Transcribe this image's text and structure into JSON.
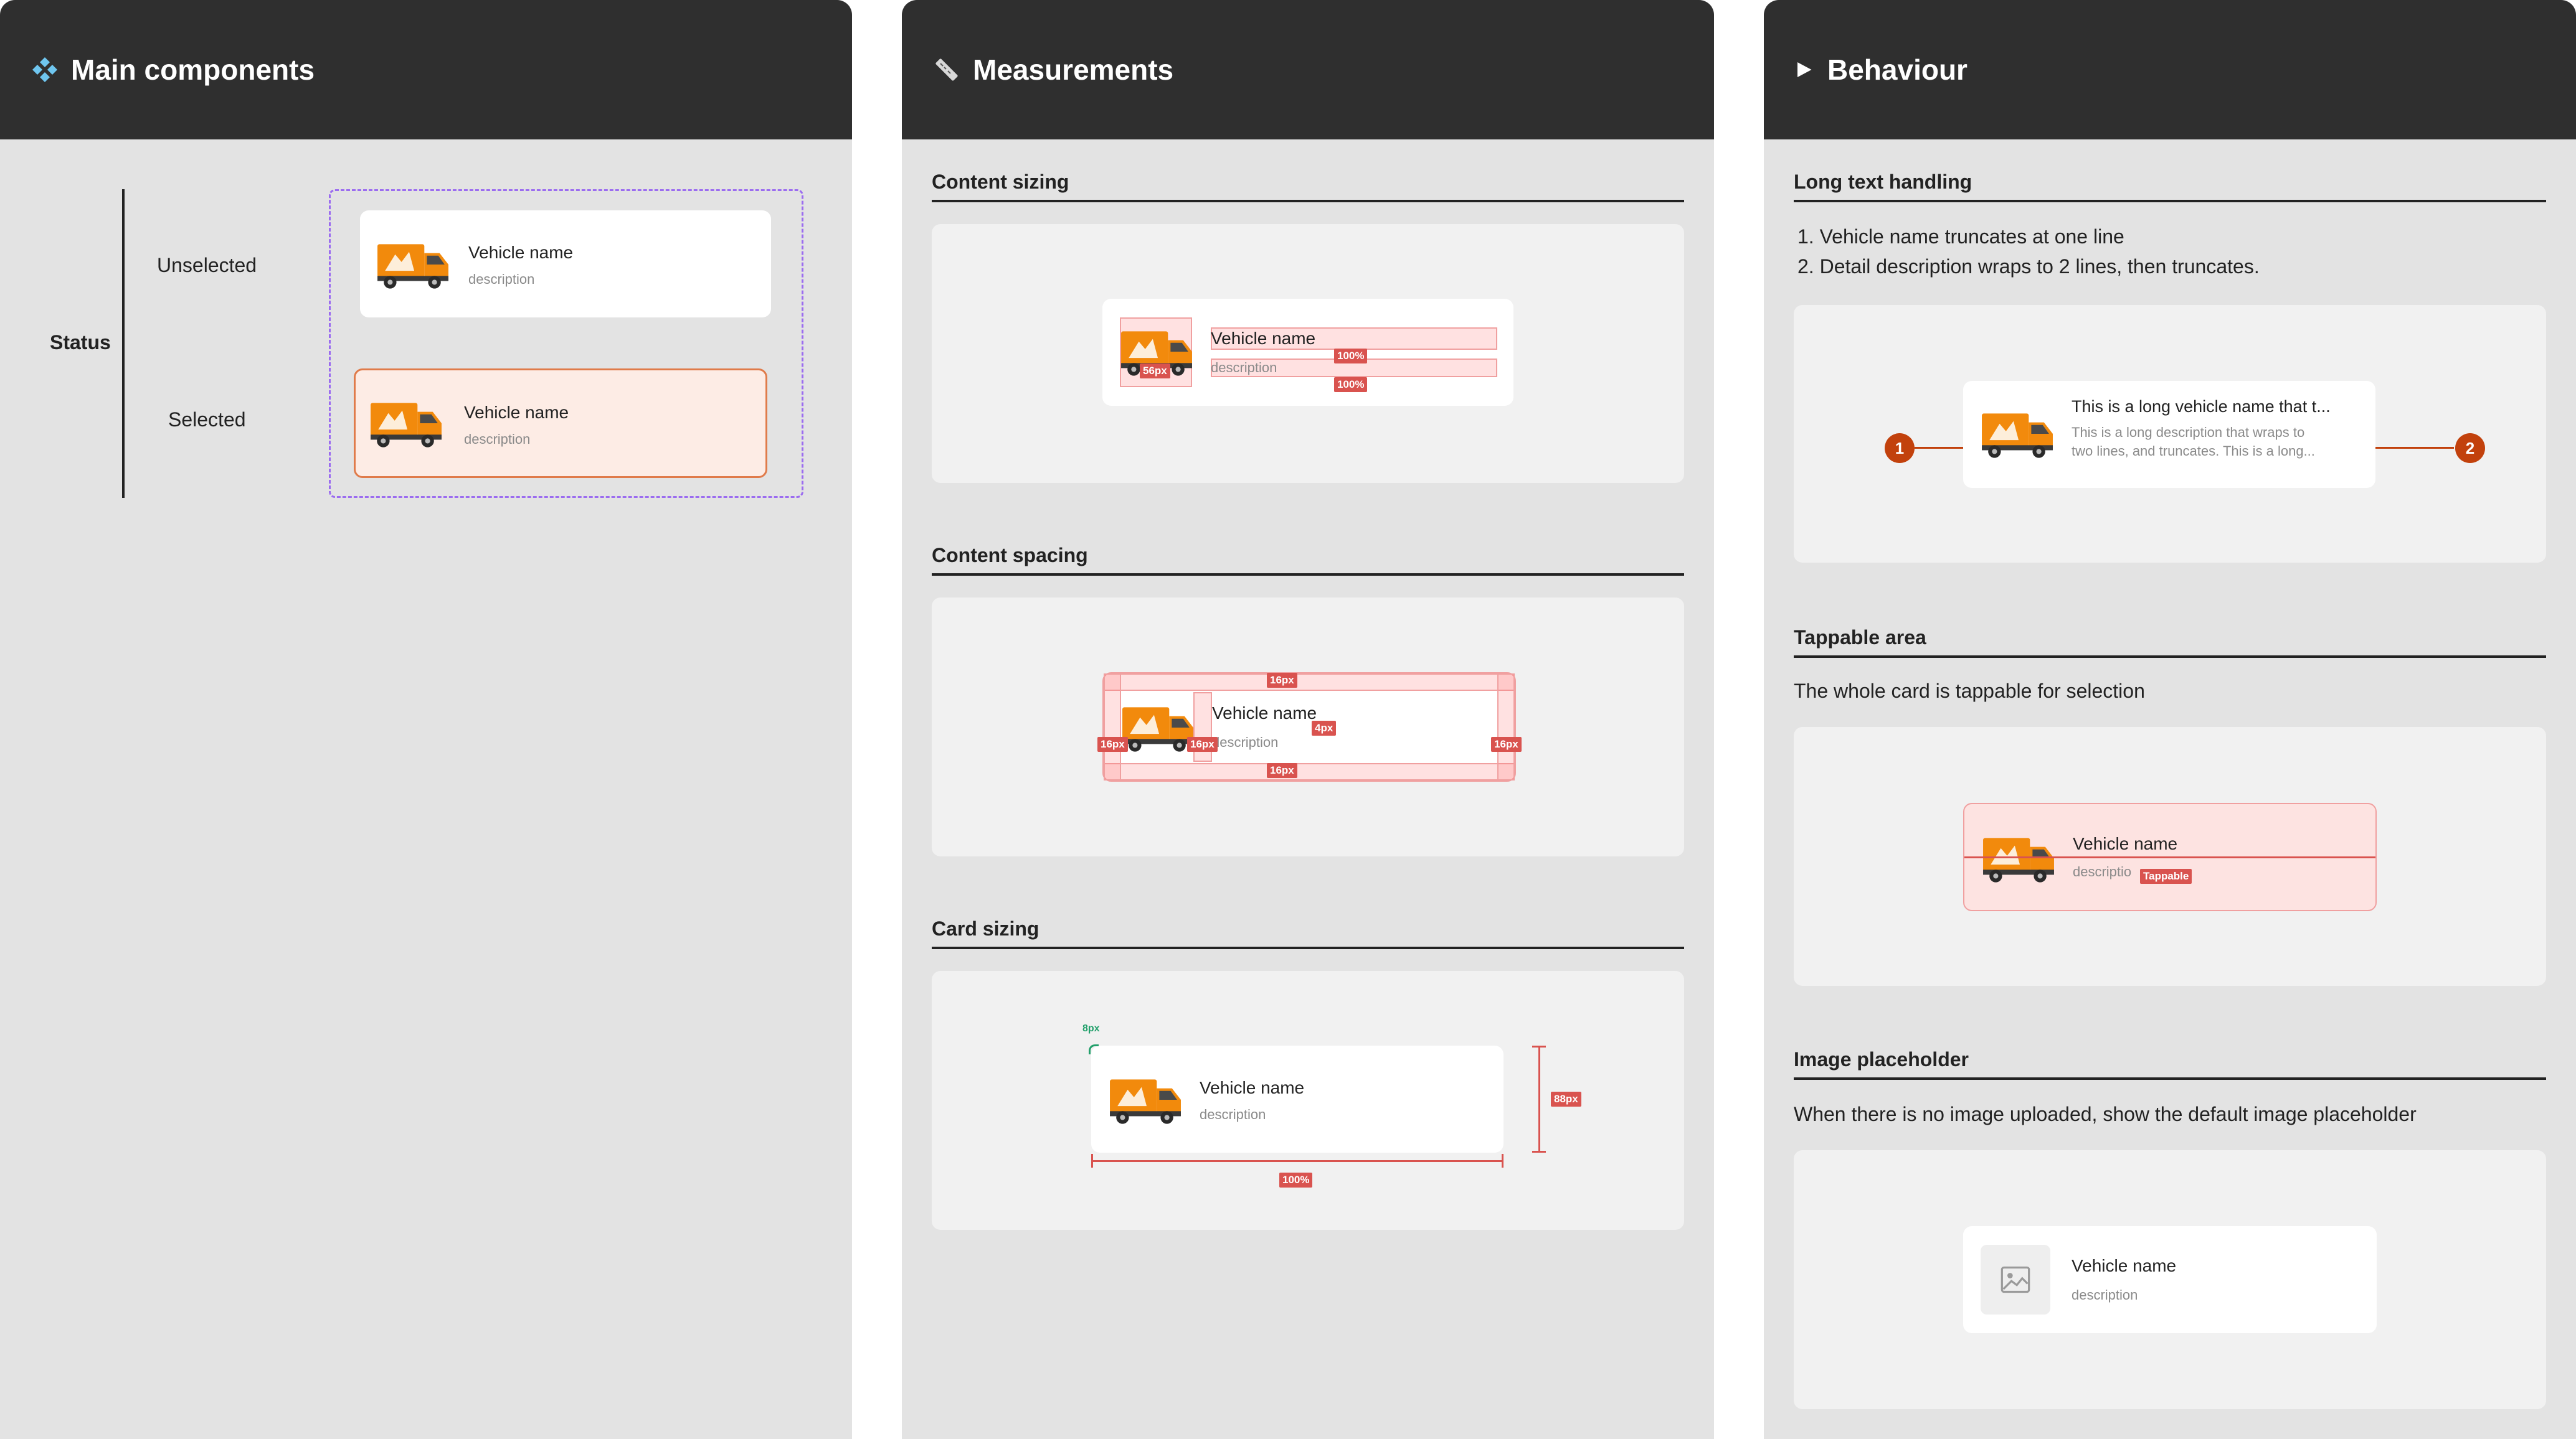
{
  "panels": {
    "main": {
      "title": "Main components",
      "icon": "component-diamond-icon",
      "status_label": "Status",
      "unselected_label": "Unselected",
      "selected_label": "Selected",
      "card_unselected": {
        "name": "Vehicle name",
        "desc": "description"
      },
      "card_selected": {
        "name": "Vehicle name",
        "desc": "description"
      }
    },
    "measurements": {
      "title": "Measurements",
      "icon": "ruler-icon",
      "content_sizing": {
        "title": "Content sizing",
        "card": {
          "name": "Vehicle name",
          "desc": "description"
        },
        "tags": [
          "56px",
          "100%",
          "100%"
        ]
      },
      "content_spacing": {
        "title": "Content spacing",
        "card": {
          "name": "Vehicle name",
          "desc": "description"
        },
        "tags": [
          "16px",
          "16px",
          "16px",
          "16px",
          "16px",
          "4px"
        ]
      },
      "card_sizing": {
        "title": "Card sizing",
        "card": {
          "name": "Vehicle name",
          "desc": "description"
        },
        "radius_tag": "8px",
        "height_tag": "88px",
        "width_tag": "100%"
      }
    },
    "behaviour": {
      "title": "Behaviour",
      "icon": "play-triangle-icon",
      "long_text": {
        "title": "Long text handling",
        "items": [
          "Vehicle name truncates at one line",
          "Detail description wraps to 2 lines, then truncates."
        ],
        "card": {
          "name": "This is a long vehicle name that t...",
          "desc_line1": "This is a long description that wraps to",
          "desc_line2": "two lines, and truncates. This is a long..."
        },
        "markers": [
          "1",
          "2"
        ]
      },
      "tappable": {
        "title": "Tappable area",
        "text": "The whole card is tappable for selection",
        "card": {
          "name": "Vehicle name",
          "desc": "descriptio"
        },
        "tag": "Tappable"
      },
      "placeholder": {
        "title": "Image placeholder",
        "text": "When there is no image uploaded, show the default image placeholder",
        "card": {
          "name": "Vehicle name",
          "desc": "description"
        },
        "icon": "image-placeholder-icon"
      }
    }
  },
  "colors": {
    "header": "#2f2f2f",
    "panel_bg": "#e3e3e3",
    "selected_border": "#e07b4a",
    "selected_bg": "#fdece5",
    "measure_red": "#d9534f",
    "marker": "#c2410c",
    "variant_outline": "#9b6cf0",
    "radius_green": "#22a06b"
  }
}
